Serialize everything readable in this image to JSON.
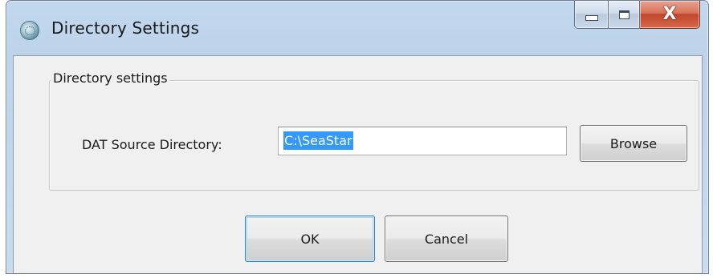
{
  "window": {
    "title": "Directory Settings",
    "icon": "app-globe-icon",
    "caption_buttons": {
      "minimize": "minimize-icon",
      "maximize": "maximize-icon",
      "close_glyph": "X"
    }
  },
  "group": {
    "legend": "Directory settings",
    "dat_source_label": "DAT Source Directory:",
    "dat_source_value": "C:\\SeaStar",
    "browse_label": "Browse"
  },
  "footer": {
    "ok_label": "OK",
    "cancel_label": "Cancel"
  },
  "colors": {
    "selection": "#3399ff",
    "close_button": "#c3462a",
    "client_bg": "#f0f0f0"
  }
}
